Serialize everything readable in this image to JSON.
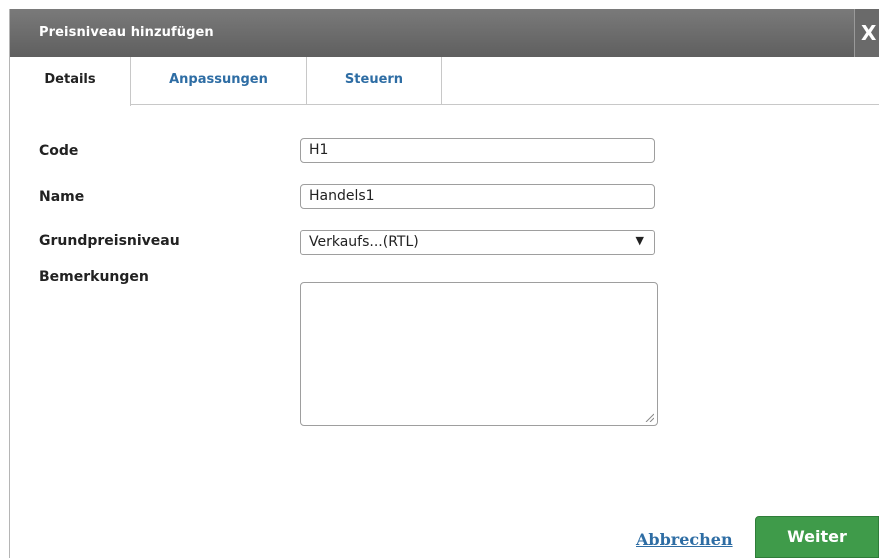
{
  "dialog": {
    "title": "Preisniveau hinzufügen",
    "close_label": "X"
  },
  "tabs": [
    {
      "label": "Details",
      "active": true
    },
    {
      "label": "Anpassungen",
      "active": false
    },
    {
      "label": "Steuern",
      "active": false
    }
  ],
  "form": {
    "code": {
      "label": "Code",
      "value": "H1"
    },
    "name": {
      "label": "Name",
      "value": "Handels1"
    },
    "base_price_level": {
      "label": "Grundpreisniveau",
      "selected": "Verkaufs...(RTL)"
    },
    "remarks": {
      "label": "Bemerkungen",
      "value": ""
    }
  },
  "footer": {
    "cancel_label": "Abbrechen",
    "next_label": "Weiter"
  },
  "colors": {
    "titlebar": "#6c6c6c",
    "tab_link": "#2e6da4",
    "primary_button": "#3f9b4a"
  },
  "icons": {
    "close": "close-icon",
    "dropdown": "chevron-down-icon",
    "resize": "resize-grip-icon"
  }
}
